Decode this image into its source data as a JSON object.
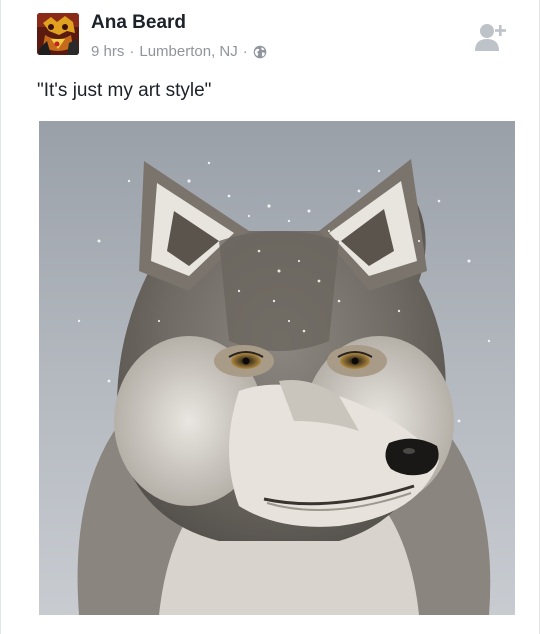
{
  "post": {
    "author": "Ana Beard",
    "time": "9 hrs",
    "location": "Lumberton, NJ",
    "separator": "·",
    "caption": "\"It's just my art style\""
  },
  "icons": {
    "privacy": "globe-icon",
    "action": "add-friend-icon"
  },
  "colors": {
    "text": "#1d2129",
    "meta": "#90949c",
    "icon": "#bec2c9"
  }
}
